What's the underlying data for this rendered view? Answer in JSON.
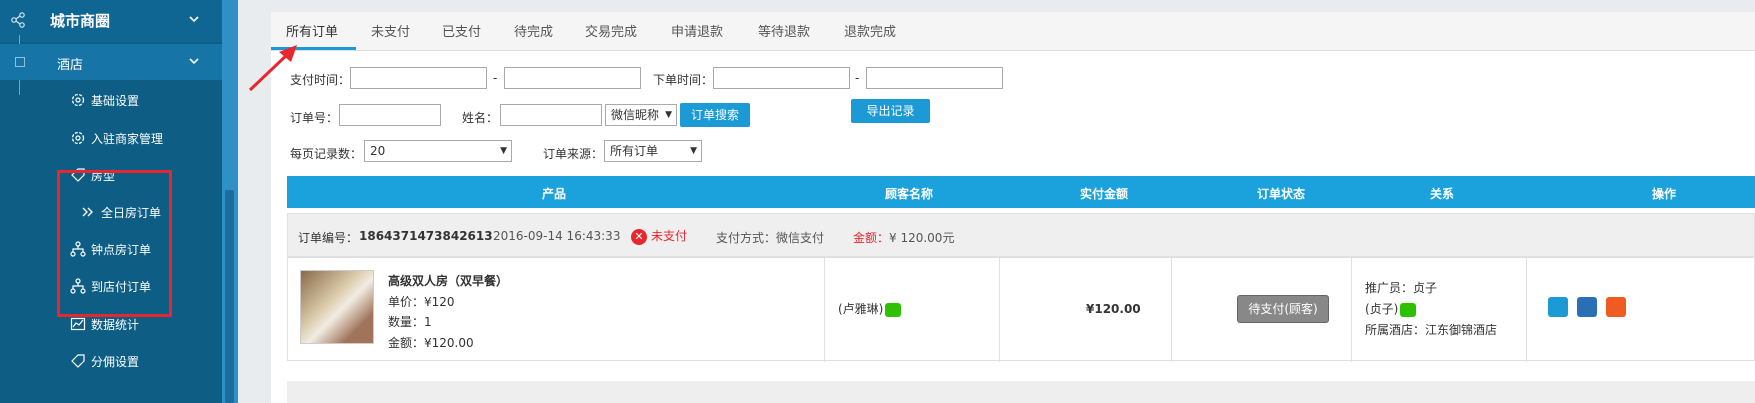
{
  "sidebar": {
    "section_title": "城市商圈",
    "group_title": "酒店",
    "items": [
      {
        "label": "基础设置",
        "icon": "gear-icon"
      },
      {
        "label": "入驻商家管理",
        "icon": "gear-icon"
      },
      {
        "label": "房型",
        "icon": "tag-icon"
      },
      {
        "label": "全日房订单",
        "icon": "double-chevron-right-icon"
      },
      {
        "label": "钟点房订单",
        "icon": "sitemap-icon"
      },
      {
        "label": "到店付订单",
        "icon": "sitemap-icon"
      },
      {
        "label": "数据统计",
        "icon": "chart-line-icon"
      },
      {
        "label": "分佣设置",
        "icon": "tag-icon"
      }
    ]
  },
  "tabs": [
    "所有订单",
    "未支付",
    "已支付",
    "待完成",
    "交易完成",
    "申请退款",
    "等待退款",
    "退款完成"
  ],
  "filters": {
    "pay_time_label": "支付时间：",
    "order_time_label": "下单时间：",
    "dash": "-",
    "order_no_label": "订单号：",
    "name_label": "姓名：",
    "name_type_select": "微信昵称",
    "search_button": "订单搜索",
    "export_button": "导出记录",
    "per_page_label": "每页记录数：",
    "per_page_value": "20",
    "source_label": "订单来源：",
    "source_value": "所有订单"
  },
  "table": {
    "headers": [
      "产品",
      "顾客名称",
      "实付金额",
      "订单状态",
      "关系",
      "操作"
    ]
  },
  "order": {
    "number_label": "订单编号：",
    "number": "1864371473842613",
    "datetime": "2016-09-14 16:43:33",
    "status": "未支付",
    "pay_method": "支付方式：微信支付",
    "amount_label": "金额：",
    "amount": "¥ 120.00元",
    "product_name": "高级双人房（双早餐）",
    "unit_price": "单价：¥120",
    "quantity": "数量：1",
    "total": "金额：¥120.00",
    "customer": "(卢雅琳)",
    "paid_amount": "¥120.00",
    "status_button": "待支付(顾客)",
    "promoter": "推广员：贞子",
    "promoter_nick": "(贞子)",
    "hotel": "所属酒店：江东御锦酒店"
  },
  "colors": {
    "accent": "#1b9ad6",
    "sidebar": "#0d5d84",
    "alert": "#e8262d"
  }
}
